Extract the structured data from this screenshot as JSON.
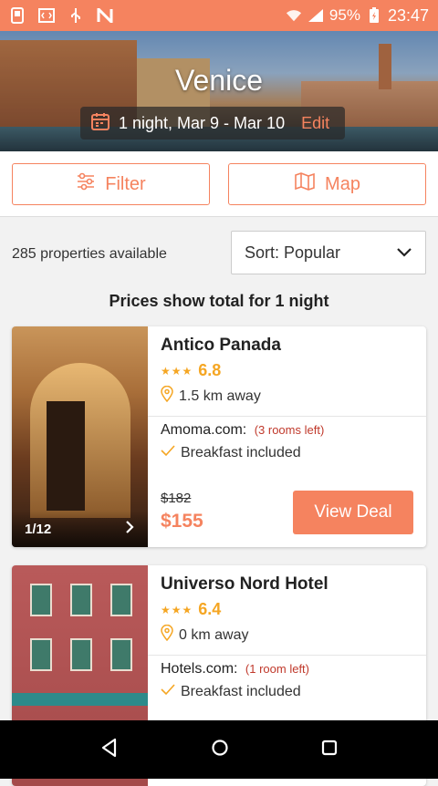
{
  "status_bar": {
    "battery": "95%",
    "time": "23:47",
    "icons": [
      "sim-icon",
      "code-icon",
      "usb-icon",
      "n-icon",
      "wifi-icon",
      "signal-icon",
      "battery-icon"
    ]
  },
  "hero": {
    "city": "Venice",
    "dates": "1 night, Mar 9 - Mar 10",
    "edit_label": "Edit",
    "calendar_icon": "calendar-icon"
  },
  "actions": {
    "filter_label": "Filter",
    "map_label": "Map",
    "filter_icon": "sliders-icon",
    "map_icon": "map-icon"
  },
  "results": {
    "count_text": "285 properties available",
    "sort_label": "Sort: Popular",
    "price_note": "Prices show total for 1 night"
  },
  "hotels": [
    {
      "name": "Antico Panada",
      "stars": 3,
      "score": "6.8",
      "distance": "1.5 km away",
      "provider": "Amoma.com:",
      "rooms_left": "(3 rooms left)",
      "amenity": "Breakfast included",
      "old_price": "$182",
      "price": "$155",
      "photo_counter": "1/12",
      "deal_label": "View Deal"
    },
    {
      "name": "Universo Nord Hotel",
      "stars": 3,
      "score": "6.4",
      "distance": "0 km away",
      "provider": "Hotels.com:",
      "rooms_left": "(1 room left)",
      "amenity": "Breakfast included"
    }
  ],
  "colors": {
    "accent": "#f5835f",
    "star": "#f5a623",
    "rooms_left": "#c0392b"
  }
}
